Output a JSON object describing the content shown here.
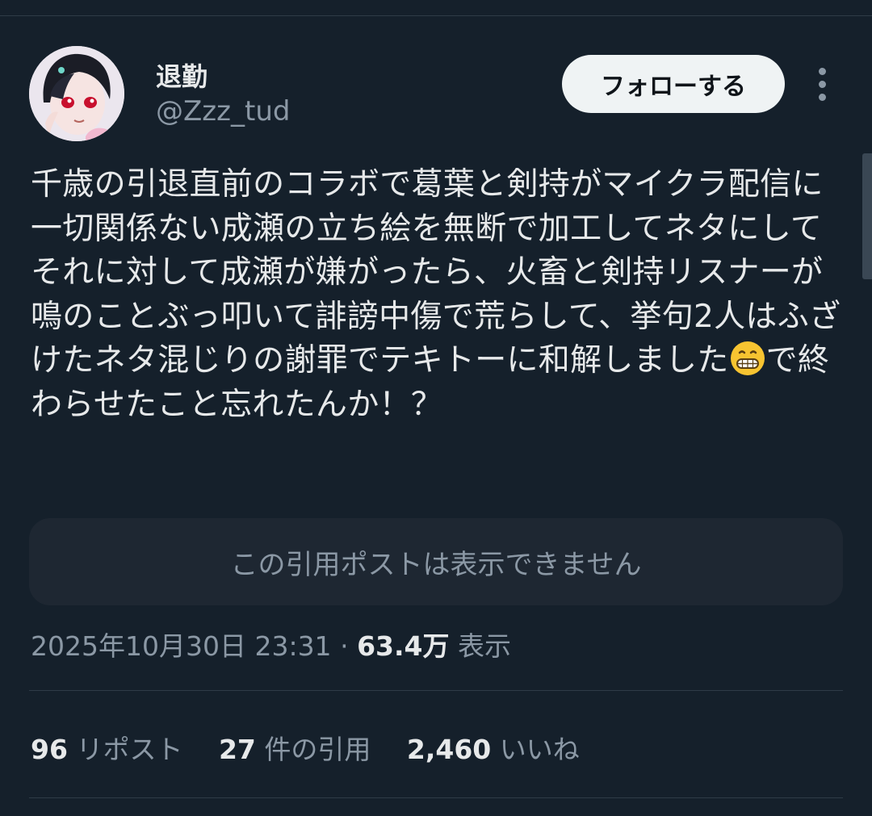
{
  "author": {
    "display_name": "退勤",
    "handle": "@Zzz_tud"
  },
  "actions": {
    "follow_label": "フォローする"
  },
  "tweet": {
    "text_before_emoji": "千歳の引退直前のコラボで葛葉と剣持がマイクラ配信に一切関係ない成瀬の立ち絵を無断で加工してネタにしてそれに対して成瀬が嫌がったら、火畜と剣持リスナーが鳴のことぶっ叩いて誹謗中傷で荒らして、挙句2人はふざけたネタ混じりの謝罪でテキトーに和解しました",
    "emoji": "grinning-face-emoji",
    "text_after_emoji": "で終わらせたこと忘れたんか！？"
  },
  "quote": {
    "unavailable_text": "この引用ポストは表示できません"
  },
  "meta": {
    "timestamp": "2025年10月30日 23:31",
    "separator": "·",
    "views_count": "63.4万",
    "views_label": "表示"
  },
  "stats": {
    "reposts_count": "96",
    "reposts_label": "リポスト",
    "quotes_count": "27",
    "quotes_label": "件の引用",
    "likes_count": "2,460",
    "likes_label": "いいね"
  },
  "colors": {
    "background": "#15202b",
    "text_primary": "#e7e9ea",
    "text_secondary": "#8b98a5",
    "follow_button_bg": "#eff3f4"
  }
}
